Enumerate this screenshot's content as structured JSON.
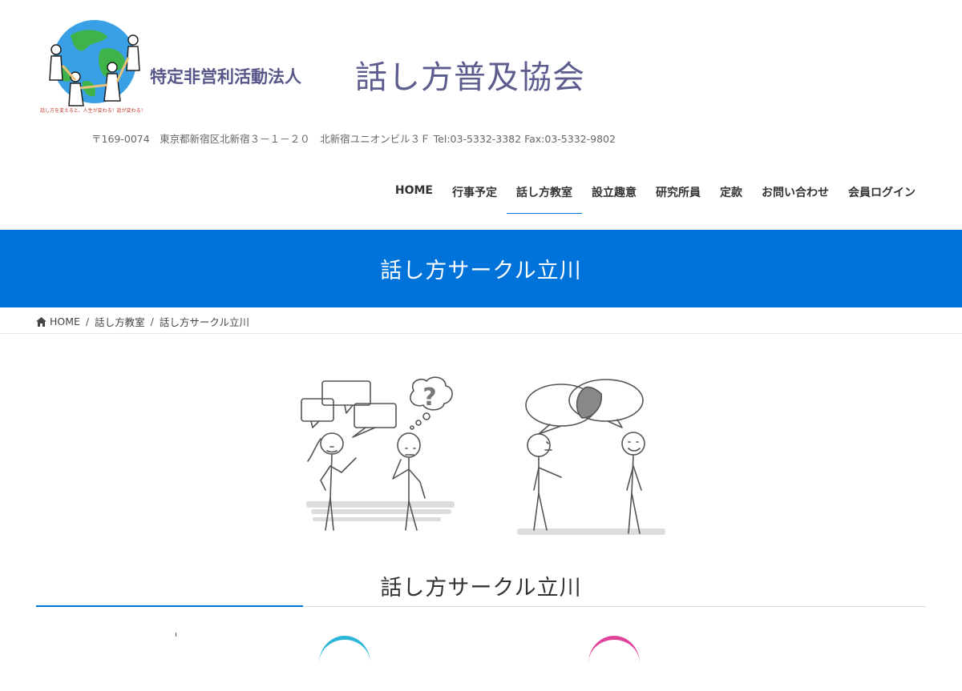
{
  "header": {
    "logo_tagline": "話し方を変えると、人生が変わる！話が変わる！",
    "org_type": "特定非営利活動法人",
    "org_name": "話し方普及協会",
    "address": "〒169-0074　東京都新宿区北新宿３－１－２０　北新宿ユニオンビル３Ｆ Tel:03-5332-3382 Fax:03-5332-9802"
  },
  "nav": {
    "items": [
      {
        "label": "HOME"
      },
      {
        "label": "行事予定"
      },
      {
        "label": "話し方教室",
        "active": true
      },
      {
        "label": "設立趣意"
      },
      {
        "label": "研究所員"
      },
      {
        "label": "定款"
      },
      {
        "label": "お問い合わせ"
      },
      {
        "label": "会員ログイン"
      }
    ]
  },
  "banner": {
    "title": "話し方サークル立川"
  },
  "breadcrumb": {
    "home": "HOME",
    "parent": "話し方教室",
    "current": "話し方サークル立川"
  },
  "illustration": {
    "question_mark": "?"
  },
  "content": {
    "title": "話し方サークル立川"
  },
  "colors": {
    "brand_blue": "#0073da",
    "org_text": "#5c5c8f",
    "accent_cyan": "#2ab5d9",
    "accent_pink": "#e0449a"
  },
  "icons": {
    "breadcrumb_home": "home-icon"
  }
}
